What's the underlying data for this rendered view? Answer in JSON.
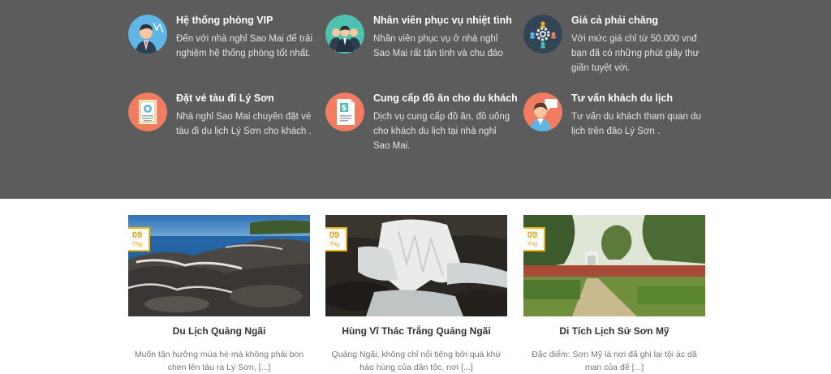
{
  "services": [
    {
      "icon": "vip-businessman-icon",
      "title": "Hệ thống phòng VIP",
      "text": "Đến với nhà nghỉ Sao Mai để trải nghiệm hệ thống phòng tốt nhất."
    },
    {
      "icon": "staff-team-icon",
      "title": "Nhân viên phục vụ nhiệt tình",
      "text": "Nhân viên phục vụ ở nhà nghỉ Sao Mai rất tận tình và chu đáo"
    },
    {
      "icon": "price-gear-people-icon",
      "title": "Giá cả phải chăng",
      "text": "Với mức giá chỉ từ 50.000 vnđ bạn đã có những phút giây thư giãn tuyệt vời."
    },
    {
      "icon": "ticket-certificate-icon",
      "title": "Đặt vé tàu đi Lý Sơn",
      "text": "Nhà nghỉ Sao Mai chuyên đặt vé tàu đi du lịch Lý Sơn cho khách ."
    },
    {
      "icon": "food-invoice-icon",
      "title": "Cung cấp đồ ăn cho du khách",
      "text": "Dịch vụ cung cấp đồ ăn, đồ uống cho khách du lịch tại nhà nghỉ Sao Mai."
    },
    {
      "icon": "consultant-person-icon",
      "title": "Tư vấn khách du lịch",
      "text": "Tư vấn du khách tham quan du lịch trên đảo Lý Sơn ."
    }
  ],
  "posts": [
    {
      "day": "09",
      "month": "Thg",
      "title": "Du Lịch Quảng Ngãi",
      "excerpt": "Muốn tận hưởng mùa hè mà không phải bon chen lên tàu ra Lý Sơn, [...]"
    },
    {
      "day": "09",
      "month": "Thg",
      "title": "Hùng Vĩ Thác Trắng Quảng Ngãi",
      "excerpt": "Quảng Ngãi, không chỉ nổi tiếng bởi quá khứ hào hùng của dân tộc, nơi [...]"
    },
    {
      "day": "09",
      "month": "Thg",
      "title": "Di Tích Lịch Sử Sơn Mỹ",
      "excerpt": "Đặc điểm: Sơn Mỹ là nơi đã ghi lại tội ác dã man của đế [...]"
    }
  ],
  "colors": {
    "band": "#5c5c5c",
    "accent": "#f0b219",
    "icon_teal": "#4fc1b0",
    "icon_blue": "#5fb6e6",
    "icon_navy": "#324556",
    "icon_coral": "#f27c61"
  }
}
